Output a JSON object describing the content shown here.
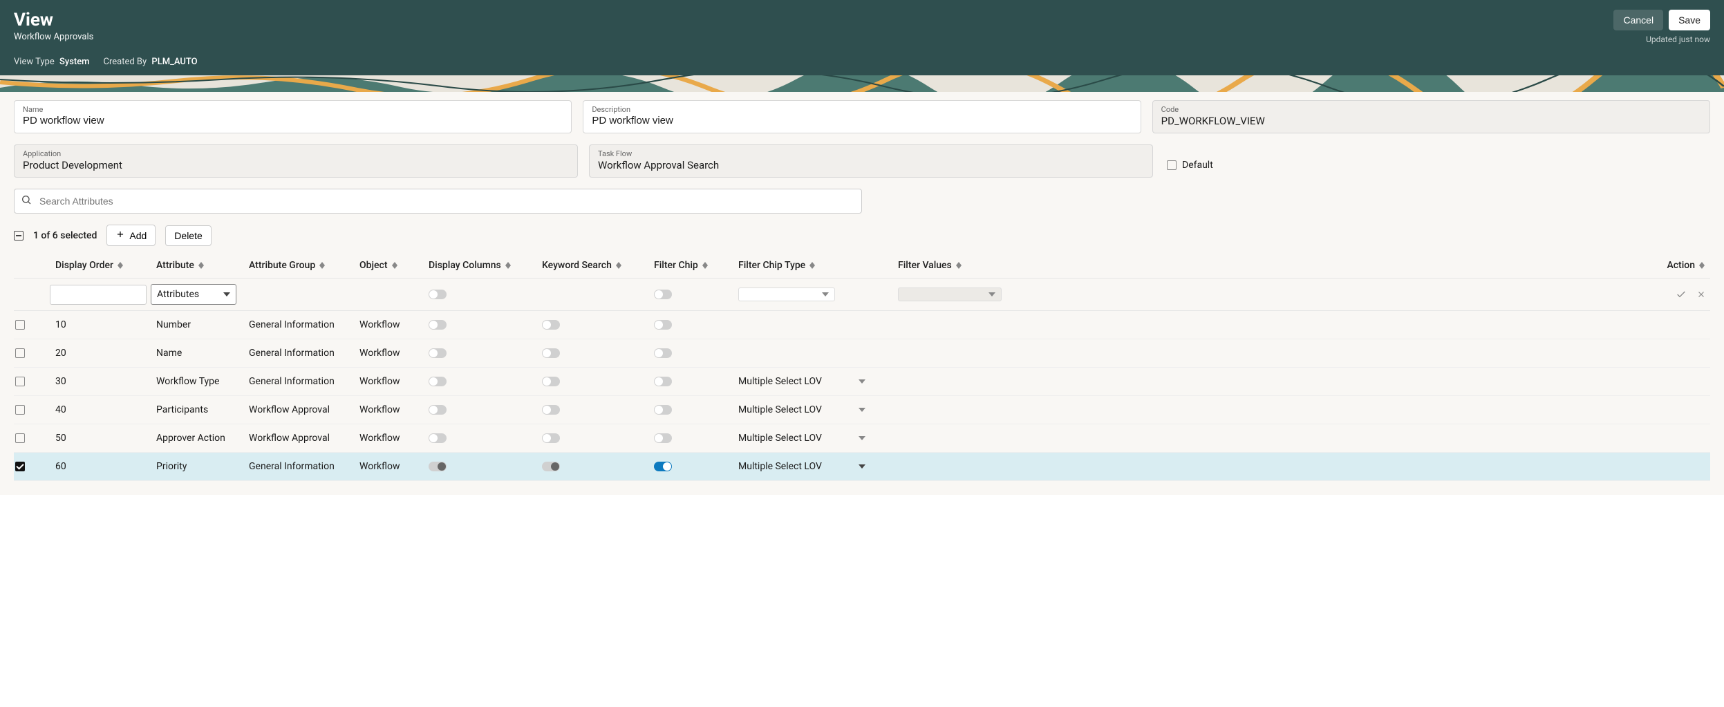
{
  "header": {
    "title": "View",
    "subtitle": "Workflow Approvals",
    "cancel_label": "Cancel",
    "save_label": "Save",
    "updated_text": "Updated just now",
    "meta": {
      "view_type_label": "View Type",
      "view_type_value": "System",
      "created_by_label": "Created By",
      "created_by_value": "PLM_AUTO"
    }
  },
  "form": {
    "name": {
      "label": "Name",
      "value": "PD workflow view"
    },
    "description": {
      "label": "Description",
      "value": "PD workflow view"
    },
    "code": {
      "label": "Code",
      "value": "PD_WORKFLOW_VIEW"
    },
    "application": {
      "label": "Application",
      "value": "Product Development"
    },
    "task_flow": {
      "label": "Task Flow",
      "value": "Workflow Approval Search"
    },
    "default_label": "Default"
  },
  "search": {
    "placeholder": "Search Attributes"
  },
  "toolbar": {
    "selected_text": "1 of 6 selected",
    "add_label": "Add",
    "delete_label": "Delete"
  },
  "columns": {
    "display_order": "Display Order",
    "attribute": "Attribute",
    "attribute_group": "Attribute Group",
    "object": "Object",
    "display_columns": "Display Columns",
    "keyword_search": "Keyword Search",
    "filter_chip": "Filter Chip",
    "filter_chip_type": "Filter Chip Type",
    "filter_values": "Filter Values",
    "action": "Action"
  },
  "filter_row": {
    "attribute_select": "Attributes"
  },
  "rows": [
    {
      "checked": false,
      "alt": false,
      "order": "10",
      "attribute": "Number",
      "group": "General Information",
      "object": "Workflow",
      "display_col": "off",
      "keyword": "off",
      "chip": "off",
      "chip_type": "",
      "filter_values": ""
    },
    {
      "checked": false,
      "alt": true,
      "order": "20",
      "attribute": "Name",
      "group": "General Information",
      "object": "Workflow",
      "display_col": "off",
      "keyword": "off",
      "chip": "off",
      "chip_type": "",
      "filter_values": ""
    },
    {
      "checked": false,
      "alt": false,
      "order": "30",
      "attribute": "Workflow Type",
      "group": "General Information",
      "object": "Workflow",
      "display_col": "off",
      "keyword": "off",
      "chip": "off",
      "chip_type": "Multiple Select LOV",
      "filter_values": ""
    },
    {
      "checked": false,
      "alt": true,
      "order": "40",
      "attribute": "Participants",
      "group": "Workflow Approval",
      "object": "Workflow",
      "display_col": "off",
      "keyword": "off",
      "chip": "off",
      "chip_type": "Multiple Select LOV",
      "filter_values": ""
    },
    {
      "checked": false,
      "alt": false,
      "order": "50",
      "attribute": "Approver Action",
      "group": "Workflow Approval",
      "object": "Workflow",
      "display_col": "off",
      "keyword": "off",
      "chip": "off",
      "chip_type": "Multiple Select LOV",
      "filter_values": ""
    },
    {
      "checked": true,
      "alt": false,
      "order": "60",
      "attribute": "Priority",
      "group": "General Information",
      "object": "Workflow",
      "display_col": "half",
      "keyword": "half",
      "chip": "on",
      "chip_type": "Multiple Select LOV",
      "filter_values": "",
      "selected": true
    }
  ]
}
